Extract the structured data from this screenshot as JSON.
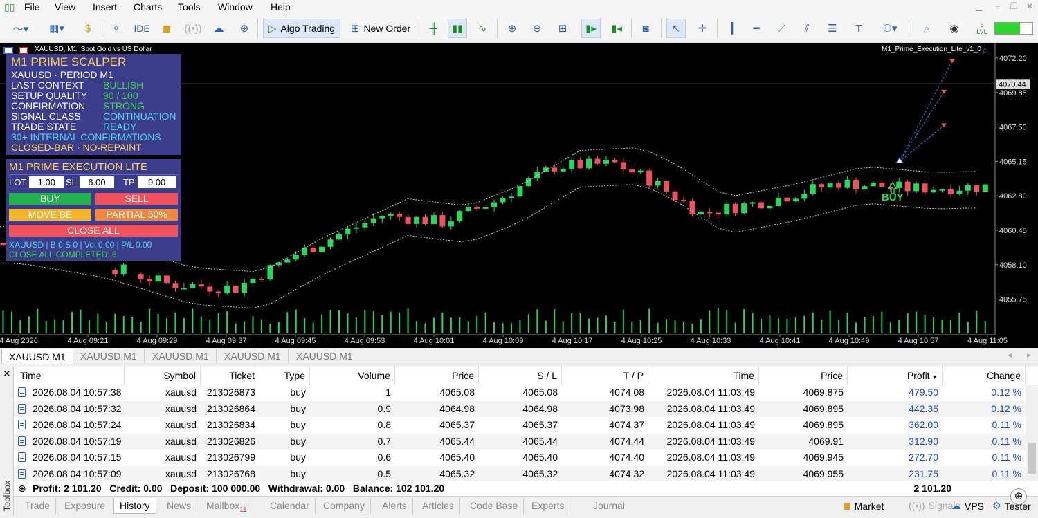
{
  "menu": [
    "File",
    "View",
    "Insert",
    "Charts",
    "Tools",
    "Window",
    "Help"
  ],
  "toolbar": {
    "algo_trading": "Algo Trading",
    "new_order": "New Order",
    "ide": "IDE",
    "lvl": "LVL"
  },
  "chart": {
    "title": "XAUUSD, M1:  Spot Gold vs US Dollar",
    "indicator_name": "M1_Prime_Execution_Lite_v1_0",
    "current_price": "4070.44",
    "price_ticks": [
      "4072.20",
      "4069.85",
      "4067.50",
      "4065.15",
      "4062.80",
      "4060.45",
      "4058.10",
      "4055.75"
    ],
    "time_ticks": [
      "4 Aug 2026",
      "4 Aug 09:21",
      "4 Aug 09:29",
      "4 Aug 09:37",
      "4 Aug 09:45",
      "4 Aug 09:53",
      "4 Aug 10:01",
      "4 Aug 10:09",
      "4 Aug 10:17",
      "4 Aug 10:25",
      "4 Aug 10:33",
      "4 Aug 10:41",
      "4 Aug 10:49",
      "4 Aug 10:57",
      "4 Aug 11:05"
    ],
    "buy_label": "BUY",
    "colors": {
      "bull": "#26d95a",
      "bear": "#f0515b",
      "background": "#000000",
      "volume": "#26d95a"
    }
  },
  "scalper_panel": {
    "title": "M1 PRIME SCALPER",
    "subtitle": "XAUUSD · PERIOD M1",
    "rows": [
      {
        "key": "LAST CONTEXT",
        "value": "BULLISH",
        "color": "green"
      },
      {
        "key": "SETUP QUALITY",
        "value": "90 / 100",
        "color": "green"
      },
      {
        "key": "CONFIRMATION",
        "value": "STRONG",
        "color": "green"
      },
      {
        "key": "SIGNAL CLASS",
        "value": "CONTINUATION",
        "color": "cyan"
      },
      {
        "key": "TRADE STATE",
        "value": "READY",
        "color": "cyan"
      }
    ],
    "line1": "30+ INTERNAL CONFIRMATIONS",
    "line2": "CLOSED-BAR · NO-REPAINT"
  },
  "execution_panel": {
    "title": "M1 PRIME EXECUTION LITE",
    "lot_label": "LOT",
    "lot_value": "1.00",
    "sl_label": "SL",
    "sl_value": "6.00",
    "tp_label": "TP",
    "tp_value": "9.00",
    "buy": "BUY",
    "sell": "SELL",
    "move_be": "MOVE BE",
    "partial": "PARTIAL 50%",
    "close_all": "CLOSE ALL",
    "status1": "XAUUSD | B 0 S 0 | Vol 0.00 | P/L 0.00",
    "status2": "CLOSE ALL COMPLETED: 6"
  },
  "chart_tabs": [
    "XAUUSD,M1",
    "XAUUSD,M1",
    "XAUUSD,M1",
    "XAUUSD,M1",
    "XAUUSD,M1"
  ],
  "history": {
    "columns": [
      "Time",
      "Symbol",
      "Ticket",
      "Type",
      "Volume",
      "Price",
      "S / L",
      "T / P",
      "Time",
      "Price",
      "Profit",
      "Change"
    ],
    "rows": [
      [
        "2026.08.04 10:57:38",
        "xauusd",
        "213026873",
        "buy",
        "1",
        "4065.08",
        "4065.08",
        "4074.08",
        "2026.08.04 11:03:49",
        "4069.875",
        "479.50",
        "0.12 %"
      ],
      [
        "2026.08.04 10:57:32",
        "xauusd",
        "213026864",
        "buy",
        "0.9",
        "4064.98",
        "4064.98",
        "4073.98",
        "2026.08.04 11:03:49",
        "4069.895",
        "442.35",
        "0.12 %"
      ],
      [
        "2026.08.04 10:57:24",
        "xauusd",
        "213026834",
        "buy",
        "0.8",
        "4065.37",
        "4065.37",
        "4074.37",
        "2026.08.04 11:03:49",
        "4069.895",
        "362.00",
        "0.11 %"
      ],
      [
        "2026.08.04 10:57:19",
        "xauusd",
        "213026826",
        "buy",
        "0.7",
        "4065.44",
        "4065.44",
        "4074.44",
        "2026.08.04 11:03:49",
        "4069.91",
        "312.90",
        "0.11 %"
      ],
      [
        "2026.08.04 10:57:15",
        "xauusd",
        "213026799",
        "buy",
        "0.6",
        "4065.40",
        "4065.40",
        "4074.40",
        "2026.08.04 11:03:49",
        "4069.945",
        "272.70",
        "0.11 %"
      ],
      [
        "2026.08.04 10:57:09",
        "xauusd",
        "213026768",
        "buy",
        "0.5",
        "4065.32",
        "4065.32",
        "4074.32",
        "2026.08.04 11:03:49",
        "4069.955",
        "231.75",
        "0.11 %"
      ]
    ],
    "summary": "Profit: 2 101.20   Credit: 0.00   Deposit: 100 000.00   Withdrawal: 0.00   Balance: 102 101.20",
    "summary_total": "2 101.20"
  },
  "toolbox_label": "Toolbox",
  "bottom_tabs": [
    "Trade",
    "Exposure",
    "History",
    "News",
    "Mailbox",
    "Calendar",
    "Company",
    "Alerts",
    "Articles",
    "Code Base",
    "Experts",
    "Journal"
  ],
  "mailbox_count": "11",
  "bottom_right": {
    "market": "Market",
    "signals": "Signals",
    "vps": "VPS",
    "tester": "Tester"
  }
}
